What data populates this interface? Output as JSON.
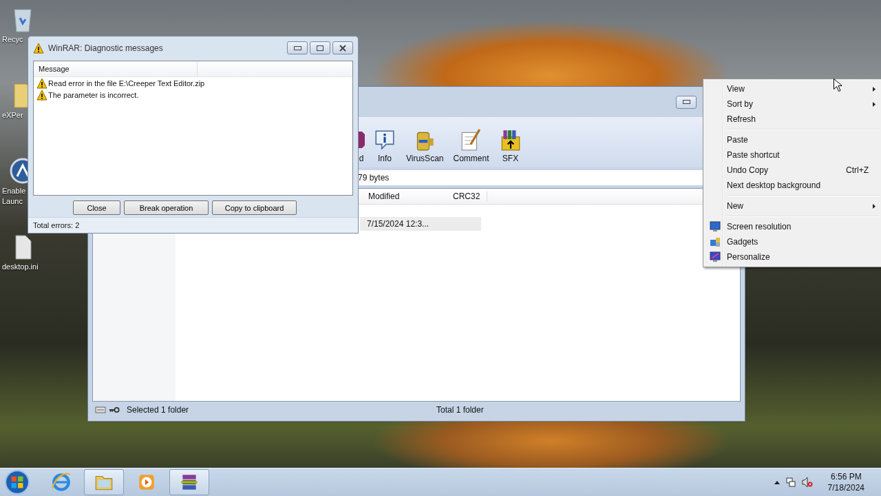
{
  "desktop_icons": [
    {
      "kind": "bin",
      "lines": [
        "Recyc"
      ]
    },
    {
      "kind": "folder",
      "lines": [
        "eXPer"
      ]
    },
    {
      "kind": "app",
      "lines": [
        "Enable",
        "Launc"
      ]
    },
    {
      "kind": "file",
      "lines": [
        "desktop.ini"
      ]
    }
  ],
  "main_window": {
    "toolbar": [
      {
        "kind": "partial",
        "label": "d"
      },
      {
        "kind": "info",
        "label": "Info"
      },
      {
        "kind": "virus",
        "label": "VirusScan"
      },
      {
        "kind": "comment",
        "label": "Comment"
      },
      {
        "kind": "sfx",
        "label": "SFX"
      }
    ],
    "address": "79 bytes",
    "columns": [
      "Modified",
      "CRC32"
    ],
    "rows": [
      {
        "modified": "7/15/2024 12:3..."
      }
    ],
    "status": [
      "Selected 1 folder",
      "Total 1 folder"
    ]
  },
  "dialog": {
    "title": "WinRAR: Diagnostic messages",
    "column": "Message",
    "messages": [
      "Read error in the file E:\\Creeper Text Editor.zip",
      "The parameter is incorrect."
    ],
    "buttons": [
      "Close",
      "Break operation",
      "Copy to clipboard"
    ],
    "status": "Total errors: 2"
  },
  "context_menu": [
    [
      {
        "label": "View",
        "submenu": true
      },
      {
        "label": "Sort by",
        "submenu": true
      },
      {
        "label": "Refresh",
        "submenu": false
      }
    ],
    [
      {
        "label": "Paste",
        "submenu": false
      },
      {
        "label": "Paste shortcut",
        "submenu": false
      },
      {
        "label": "Undo Copy",
        "shortcut": "Ctrl+Z",
        "submenu": false
      },
      {
        "label": "Next desktop background",
        "submenu": false
      }
    ],
    [
      {
        "label": "New",
        "submenu": true
      }
    ],
    [
      {
        "label": "Screen resolution",
        "kind": "screen",
        "submenu": false
      },
      {
        "label": "Gadgets",
        "kind": "gadgets",
        "submenu": false
      },
      {
        "label": "Personalize",
        "kind": "personalize",
        "submenu": false
      }
    ]
  ],
  "taskbar": {
    "buttons": [
      {
        "kind": "ie",
        "running": false
      },
      {
        "kind": "explorer",
        "running": true
      },
      {
        "kind": "media",
        "running": false
      },
      {
        "kind": "winrar",
        "running": true
      }
    ],
    "time": "6:56 PM",
    "date": "7/18/2024"
  }
}
